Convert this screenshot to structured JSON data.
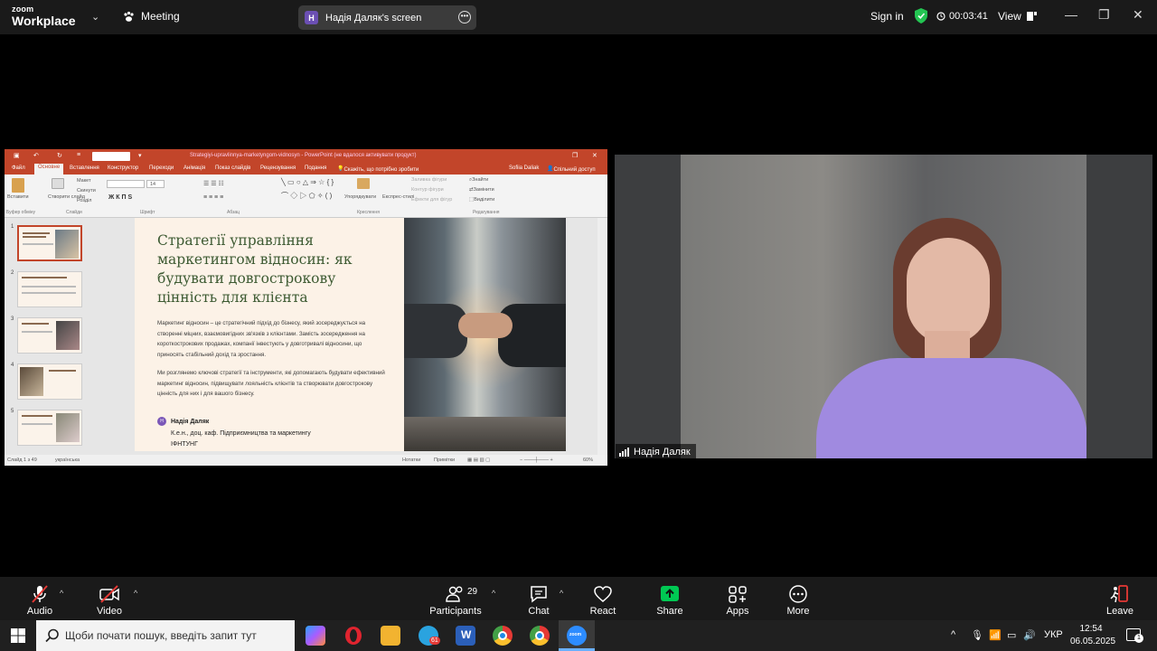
{
  "zoom": {
    "logo_line1": "zoom",
    "logo_line2": "Workplace",
    "meeting_label": "Meeting",
    "screen_owner_initial": "H",
    "screen_label": "Надія Даляк's screen",
    "sign_in": "Sign in",
    "timer": "00:03:41",
    "view_label": "View"
  },
  "powerpoint": {
    "window_title": "Strategiyi-upravlinnya-marketyngom-vidnosyn - PowerPoint (не вдалося активувати продукт)",
    "tabs": [
      "Файл",
      "Основне",
      "Вставлення",
      "Конструктор",
      "Переходи",
      "Анімація",
      "Показ слайдів",
      "Рецензування",
      "Подання"
    ],
    "tell_me": "Скажіть, що потрібно зробити",
    "user": "Sofiia Daliak",
    "share_btn": "Спільний доступ",
    "ribbon": {
      "paste": "Вставити",
      "clipboard": "Буфер обміну",
      "new_slide": "Створити слайд",
      "layout": "Макет",
      "reset": "Скинути",
      "section": "Розділ",
      "slides": "Слайди",
      "font_group": "Шрифт",
      "font_size": "14",
      "paragraph": "Абзац",
      "arrange": "Упорядкувати",
      "quick_styles": "Експрес-стилі",
      "shape_fill": "Заливка фігури",
      "shape_outline": "Контур фігури",
      "shape_effects": "Ефекти для фігур",
      "drawing": "Креслення",
      "find": "Знайти",
      "replace": "Замінити",
      "select": "Виділити",
      "editing": "Редагування"
    },
    "slide_numbers": [
      "1",
      "2",
      "3",
      "4",
      "5"
    ],
    "slide": {
      "title": "Стратегії управління маркетингом відносин: як будувати довгострокову цінність для клієнта",
      "para1": "Маркетинг відносин – це стратегічний підхід до бізнесу, який зосереджується на створенні міцних, взаємовигідних зв'язків з клієнтами. Замість зосередження на короткострокових продажах, компанії інвестують у довготривалі відносини, що приносять стабільний дохід та зростання.",
      "para2": "Ми розглянемо ключові стратегії та інструменти, які допомагають будувати ефективний маркетинг відносин, підвищувати лояльність клієнтів та створювати довгострокову цінність для них і для вашого бізнесу.",
      "author_initial": "H",
      "author_name": "Надія Даляк",
      "author_title": "К.е.н., доц. каф. Підприємництва та маркетингу",
      "author_org": "ІФНТУНГ"
    },
    "status": {
      "slide_of": "Слайд 1 з 49",
      "language": "українська",
      "notes": "Нотатки",
      "comments": "Примітки",
      "zoom": "60%"
    }
  },
  "participant": {
    "name": "Надія Даляк"
  },
  "toolbar": {
    "audio": "Audio",
    "video": "Video",
    "participants": "Participants",
    "participants_count": "29",
    "chat": "Chat",
    "react": "React",
    "share": "Share",
    "apps": "Apps",
    "more": "More",
    "leave": "Leave"
  },
  "taskbar": {
    "search_placeholder": "Щоби почати пошук, введіть запит тут",
    "telegram_badge": "61",
    "language": "УКР",
    "time": "12:54",
    "date": "06.05.2025",
    "notifications": "1"
  },
  "colors": {
    "zoom_bg": "#1a1a1a",
    "ppt_accent": "#c2452a",
    "share_green": "#00c853",
    "slide_title": "#3d5a32"
  }
}
